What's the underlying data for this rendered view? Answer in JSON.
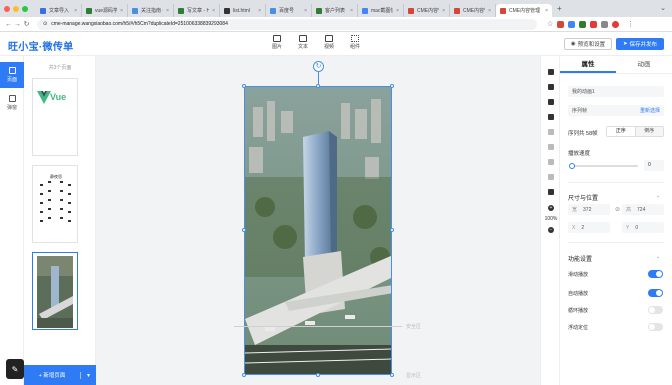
{
  "browser": {
    "tabs": [
      {
        "label": "文章导入",
        "fav": "#3b6fe0"
      },
      {
        "label": "vue源码学习",
        "fav": "#2e7d32"
      },
      {
        "label": "关注指南 - 百",
        "fav": "#4a90e2"
      },
      {
        "label": "写文章 - H5",
        "fav": "#2e7d32"
      },
      {
        "label": "list.html",
        "fav": "#333333"
      },
      {
        "label": "百度号",
        "fav": "#4a90e2"
      },
      {
        "label": "客户列表",
        "fav": "#2e7d32"
      },
      {
        "label": "mac截图快",
        "fav": "#4285f4"
      },
      {
        "label": "CME内容管",
        "fav": "#d14836"
      },
      {
        "label": "CME内容管",
        "fav": "#d14836"
      },
      {
        "label": "CME内容管理",
        "fav": "#d14836"
      }
    ],
    "new_tab": "+",
    "url": "cme-manage.wangxiaobao.com/h5/#/h5Cm?duplicateId=251006338839293084"
  },
  "header": {
    "logo": "旺小宝·微传单",
    "tools": [
      "图片",
      "文本",
      "视频",
      "组件"
    ],
    "preview_label": "预览和设置",
    "save_label": "保存并发布"
  },
  "rail": {
    "items": [
      "页面",
      "弹窗"
    ]
  },
  "pages": {
    "title": "共3个页面",
    "numbers": [
      "1",
      "2",
      "3"
    ],
    "thumb1_text": "Vue",
    "poem_title": "静夜思",
    "add_label": "+ 新增页面"
  },
  "canvas": {
    "guide_label_1": "安全区",
    "guide_label_2": "显示区"
  },
  "zoom": "100%",
  "props": {
    "tab_props": "属性",
    "tab_anim": "动画",
    "name_field": "我的动画1",
    "seq_field": "序列帧",
    "reselect": "重新选择",
    "seq_count": "序列共 58帧",
    "order_forward": "正序",
    "order_reverse": "倒序",
    "speed_label": "播放速度",
    "speed_value": "0",
    "speed_fraction": 0,
    "size_section": "尺寸与位置",
    "w_label": "宽",
    "w_value": "372",
    "h_label": "高",
    "h_value": "724",
    "x_label": "X",
    "x_value": "2",
    "y_label": "Y",
    "y_value": "0",
    "func_section": "功能设置",
    "toggles": [
      {
        "label": "滑动播放",
        "on": true
      },
      {
        "label": "自动播放",
        "on": true
      },
      {
        "label": "循环播放",
        "on": false
      },
      {
        "label": "浮动定位",
        "on": false
      }
    ]
  }
}
